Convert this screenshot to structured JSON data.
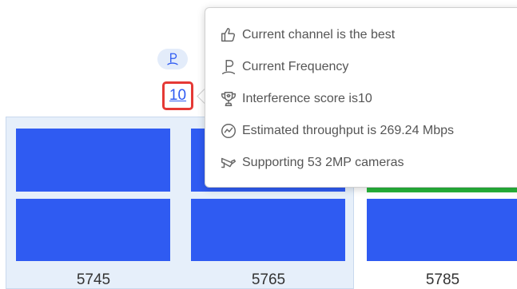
{
  "channels": [
    {
      "label": "5745"
    },
    {
      "label": "5765"
    },
    {
      "label": "5785"
    }
  ],
  "current_channel": {
    "frequency_icon": "wifi-frequency-icon",
    "interference_score": "10"
  },
  "tooltip": {
    "items": [
      {
        "icon": "thumbs-up-icon",
        "text": "Current channel is the best"
      },
      {
        "icon": "wifi-frequency-icon",
        "text": "Current Frequency"
      },
      {
        "icon": "trophy-icon",
        "text": "Interference score is10"
      },
      {
        "icon": "speedometer-icon",
        "text": "Estimated throughput is 269.24 Mbps"
      },
      {
        "icon": "camera-icon",
        "text": "Supporting 53 2MP cameras"
      }
    ]
  },
  "colors": {
    "bar_blue": "#2f5bf2",
    "quality_green": "#27b53b",
    "highlight_bg": "#e6effa",
    "score_border": "#e53935"
  }
}
